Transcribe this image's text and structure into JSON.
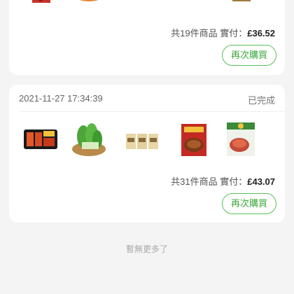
{
  "orders": [
    {
      "date": "",
      "status": "",
      "summary_prefix": "共",
      "item_count": "19",
      "summary_unit": "件商品 實付：",
      "total": "£36.52",
      "rebuy_label": "再次購買",
      "products": [
        {
          "name": "spicy-noodle-pack-image"
        },
        {
          "name": "chili-powder-bowl-image"
        },
        {
          "name": "seasoning-pouch-image"
        },
        {
          "name": "black-sauce-jar-image"
        },
        {
          "name": "dumpling-wrapper-image"
        }
      ]
    },
    {
      "date": "2021-11-27 17:34:39",
      "status": "已完成",
      "summary_prefix": "共",
      "item_count": "31",
      "summary_unit": "件商品 實付：",
      "total": "£43.07",
      "rebuy_label": "再次購買",
      "products": [
        {
          "name": "sausage-pack-image"
        },
        {
          "name": "bok-choy-basket-image"
        },
        {
          "name": "noodle-packs-image"
        },
        {
          "name": "hot-pot-sauce-image"
        },
        {
          "name": "braised-pork-seasoning-image"
        }
      ]
    }
  ],
  "footer": {
    "no_more": "暫無更多了"
  },
  "colors": {
    "accent": "#3aa83a",
    "background": "#f4f4f4",
    "card": "#ffffff"
  }
}
